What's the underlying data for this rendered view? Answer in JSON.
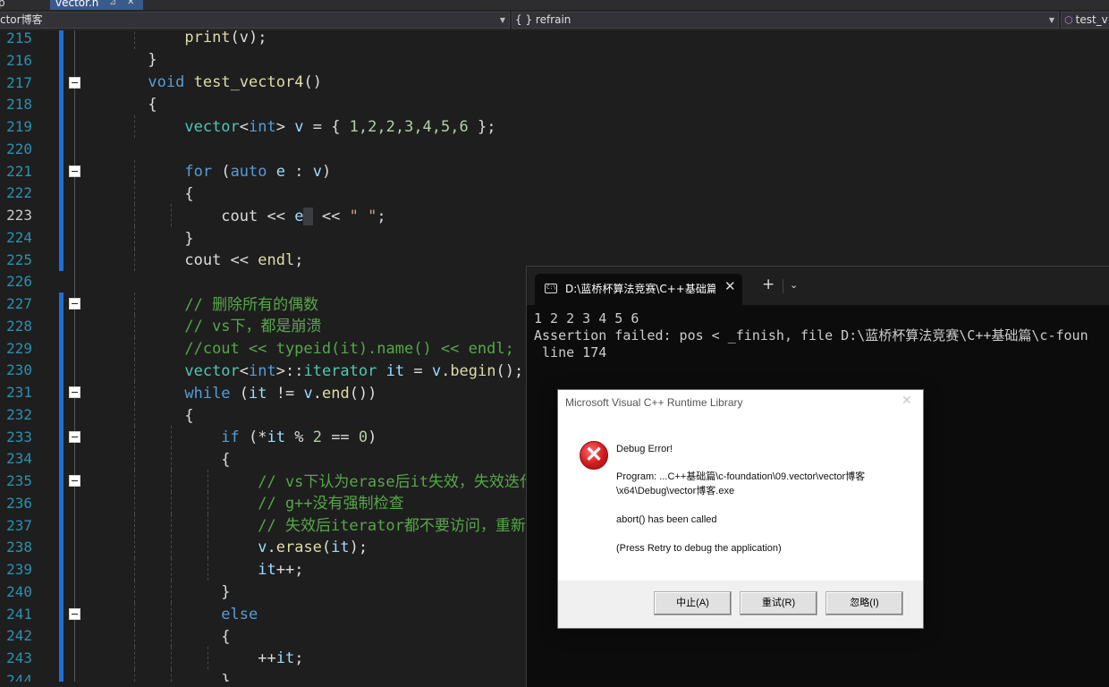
{
  "tabs": {
    "left_partial": "p",
    "active": "vector.h",
    "pin": "⊿",
    "close": "✕"
  },
  "navbar": {
    "project": "ctor博客",
    "scope": "{ } refrain",
    "member": "test_v"
  },
  "editor": {
    "current_line": 223,
    "lines": [
      {
        "n": "215"
      },
      {
        "n": "216"
      },
      {
        "n": "217"
      },
      {
        "n": "218"
      },
      {
        "n": "219"
      },
      {
        "n": "220"
      },
      {
        "n": "221"
      },
      {
        "n": "222"
      },
      {
        "n": "223"
      },
      {
        "n": "224"
      },
      {
        "n": "225"
      },
      {
        "n": "226"
      },
      {
        "n": "227"
      },
      {
        "n": "228"
      },
      {
        "n": "229"
      },
      {
        "n": "230"
      },
      {
        "n": "231"
      },
      {
        "n": "232"
      },
      {
        "n": "233"
      },
      {
        "n": "234"
      },
      {
        "n": "235"
      },
      {
        "n": "236"
      },
      {
        "n": "237"
      },
      {
        "n": "238"
      },
      {
        "n": "239"
      },
      {
        "n": "240"
      },
      {
        "n": "241"
      },
      {
        "n": "242"
      },
      {
        "n": "243"
      },
      {
        "n": "244"
      }
    ],
    "code": {
      "l215_fn": "print",
      "l215_rest": "(v);",
      "l216": "}",
      "l217_kw": "void",
      "l217_fn": "test_vector4",
      "l217_rest": "()",
      "l218": "{",
      "l219_a": "vector",
      "l219_b": "<",
      "l219_type": "int",
      "l219_c": "> ",
      "l219_var": "v",
      "l219_d": " = { ",
      "l219_nums": "1,2,2,3,4,5,6",
      "l219_e": " };",
      "l221_kw": "for",
      "l221_a": " (",
      "l221_auto": "auto",
      "l221_b": " ",
      "l221_e": "e",
      "l221_c": " : ",
      "l221_v": "v",
      "l221_d": ")",
      "l222": "{",
      "l223_a": "cout << ",
      "l223_e": "e",
      "l223_b": " << ",
      "l223_str": "\" \"",
      "l223_c": ";",
      "l224": "}",
      "l225_a": "cout << ",
      "l225_b": "endl",
      "l225_c": ";",
      "l227": "// 删除所有的偶数",
      "l228": "// vs下，都是崩溃",
      "l229": "//cout << typeid(it).name() << endl;",
      "l230_a": "vector",
      "l230_b": "<",
      "l230_type": "int",
      "l230_c": ">::",
      "l230_d": "iterator",
      "l230_e": " ",
      "l230_it": "it",
      "l230_f": " = ",
      "l230_v": "v",
      "l230_g": ".",
      "l230_fn": "begin",
      "l230_h": "();",
      "l231_kw": "while",
      "l231_a": " (",
      "l231_it": "it",
      "l231_b": " != ",
      "l231_v": "v",
      "l231_c": ".",
      "l231_fn": "end",
      "l231_d": "())",
      "l232": "{",
      "l233_kw": "if",
      "l233_a": " (*",
      "l233_it": "it",
      "l233_b": " % ",
      "l233_n1": "2",
      "l233_c": " == ",
      "l233_n2": "0",
      "l233_d": ")",
      "l234": "{",
      "l235": "// vs下认为erase后it失效，失效迭代",
      "l236": "// g++没有强制检查",
      "l237": "// 失效后iterator都不要访问，重新",
      "l238_v": "v",
      "l238_a": ".",
      "l238_fn": "erase",
      "l238_b": "(",
      "l238_it": "it",
      "l238_c": ");",
      "l239_it": "it",
      "l239_a": "++;",
      "l240": "}",
      "l241_kw": "else",
      "l242": "{",
      "l243_a": "++",
      "l243_it": "it",
      "l243_b": ";",
      "l244": "}"
    }
  },
  "console": {
    "tab_icon": "C:\\",
    "tab_title": "D:\\蓝桥杯算法竞赛\\C++基础篇",
    "tab_close": "✕",
    "new_tab": "+",
    "dropdown": "⌄",
    "output_line1": "1 2 2 3 4 5 6",
    "output_line2": "Assertion failed: pos < _finish, file D:\\蓝桥杯算法竞赛\\C++基础篇\\c-foun",
    "output_line3": " line 174"
  },
  "dialog": {
    "title": "Microsoft Visual C++ Runtime Library",
    "close": "✕",
    "icon": "✕",
    "heading": "Debug Error!",
    "program_line1": "Program: ...C++基础篇\\c-foundation\\09.vector\\vector博客",
    "program_line2": "\\x64\\Debug\\vector博客.exe",
    "message": "abort() has been called",
    "hint": "(Press Retry to debug the application)",
    "buttons": {
      "abort": "中止(A)",
      "retry": "重试(R)",
      "ignore": "忽略(I)"
    }
  }
}
